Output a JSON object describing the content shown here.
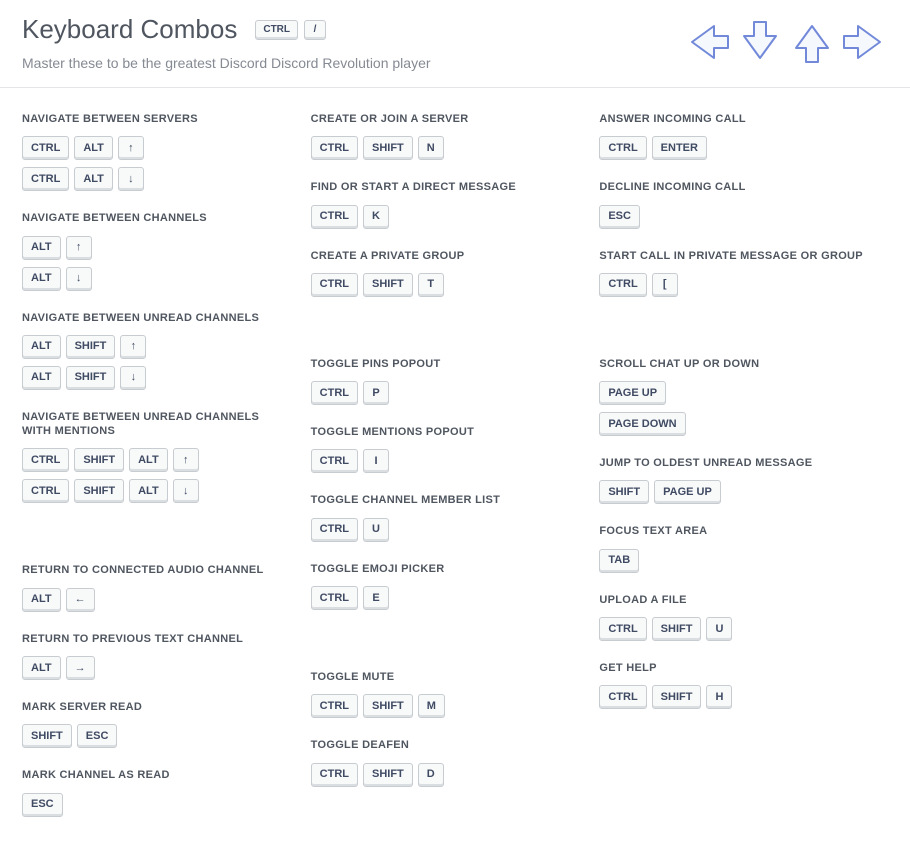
{
  "header": {
    "title": "Keyboard Combos",
    "subtitle": "Master these to be the greatest Discord Discord Revolution player",
    "title_keys": [
      "CTRL",
      "/"
    ]
  },
  "columns": [
    [
      {
        "label": "NAVIGATE BETWEEN SERVERS",
        "combos": [
          [
            "CTRL",
            "ALT",
            "↑"
          ],
          [
            "CTRL",
            "ALT",
            "↓"
          ]
        ]
      },
      {
        "label": "NAVIGATE BETWEEN CHANNELS",
        "combos": [
          [
            "ALT",
            "↑"
          ],
          [
            "ALT",
            "↓"
          ]
        ]
      },
      {
        "label": "NAVIGATE BETWEEN UNREAD CHANNELS",
        "combos": [
          [
            "ALT",
            "SHIFT",
            "↑"
          ],
          [
            "ALT",
            "SHIFT",
            "↓"
          ]
        ]
      },
      {
        "label": "NAVIGATE BETWEEN UNREAD CHANNELS WITH MENTIONS",
        "combos": [
          [
            "CTRL",
            "SHIFT",
            "ALT",
            "↑"
          ],
          [
            "CTRL",
            "SHIFT",
            "ALT",
            "↓"
          ]
        ]
      },
      {
        "gap": true
      },
      {
        "label": "RETURN TO CONNECTED AUDIO CHANNEL",
        "combos": [
          [
            "ALT",
            "←"
          ]
        ]
      },
      {
        "label": "RETURN TO PREVIOUS TEXT CHANNEL",
        "combos": [
          [
            "ALT",
            "→"
          ]
        ]
      },
      {
        "label": "MARK SERVER READ",
        "combos": [
          [
            "SHIFT",
            "ESC"
          ]
        ]
      },
      {
        "label": "MARK CHANNEL AS READ",
        "combos": [
          [
            "ESC"
          ]
        ]
      }
    ],
    [
      {
        "label": "CREATE OR JOIN A SERVER",
        "combos": [
          [
            "CTRL",
            "SHIFT",
            "N"
          ]
        ]
      },
      {
        "label": "FIND OR START A DIRECT MESSAGE",
        "combos": [
          [
            "CTRL",
            "K"
          ]
        ]
      },
      {
        "label": "CREATE A PRIVATE GROUP",
        "combos": [
          [
            "CTRL",
            "SHIFT",
            "T"
          ]
        ]
      },
      {
        "gap": true
      },
      {
        "label": "TOGGLE PINS POPOUT",
        "combos": [
          [
            "CTRL",
            "P"
          ]
        ]
      },
      {
        "label": "TOGGLE MENTIONS POPOUT",
        "combos": [
          [
            "CTRL",
            "I"
          ]
        ]
      },
      {
        "label": "TOGGLE CHANNEL MEMBER LIST",
        "combos": [
          [
            "CTRL",
            "U"
          ]
        ]
      },
      {
        "label": "TOGGLE EMOJI PICKER",
        "combos": [
          [
            "CTRL",
            "E"
          ]
        ]
      },
      {
        "gap": true
      },
      {
        "label": "TOGGLE MUTE",
        "combos": [
          [
            "CTRL",
            "SHIFT",
            "M"
          ]
        ]
      },
      {
        "label": "TOGGLE DEAFEN",
        "combos": [
          [
            "CTRL",
            "SHIFT",
            "D"
          ]
        ]
      }
    ],
    [
      {
        "label": "ANSWER INCOMING CALL",
        "combos": [
          [
            "CTRL",
            "ENTER"
          ]
        ]
      },
      {
        "label": "DECLINE INCOMING CALL",
        "combos": [
          [
            "ESC"
          ]
        ]
      },
      {
        "label": "START CALL IN PRIVATE MESSAGE OR GROUP",
        "combos": [
          [
            "CTRL",
            "["
          ]
        ]
      },
      {
        "gap": true
      },
      {
        "label": "SCROLL CHAT UP OR DOWN",
        "combos": [
          [
            "PAGE UP"
          ],
          [
            "PAGE DOWN"
          ]
        ]
      },
      {
        "label": "JUMP TO OLDEST UNREAD MESSAGE",
        "combos": [
          [
            "SHIFT",
            "PAGE UP"
          ]
        ]
      },
      {
        "label": "FOCUS TEXT AREA",
        "combos": [
          [
            "TAB"
          ]
        ]
      },
      {
        "label": "UPLOAD A FILE",
        "combos": [
          [
            "CTRL",
            "SHIFT",
            "U"
          ]
        ]
      },
      {
        "label": "GET HELP",
        "combos": [
          [
            "CTRL",
            "SHIFT",
            "H"
          ]
        ]
      }
    ]
  ]
}
